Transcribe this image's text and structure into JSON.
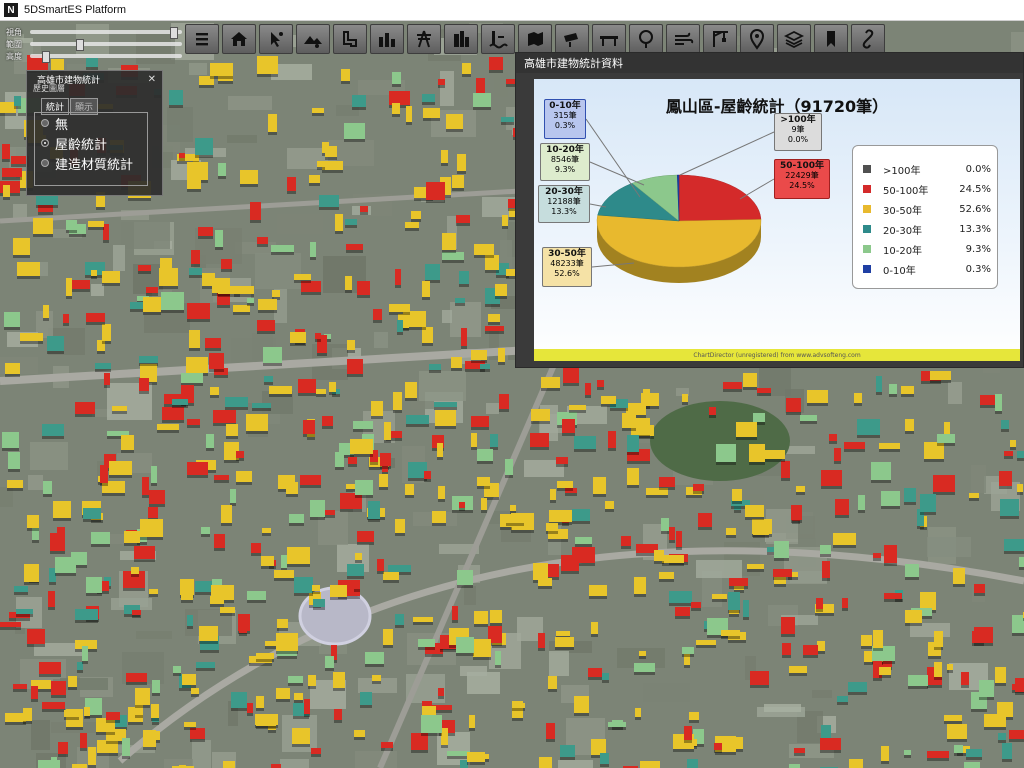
{
  "window": {
    "title": "5DSmartES Platform",
    "icon_letter": "N"
  },
  "sliders": [
    {
      "label": "視角"
    },
    {
      "label": "範圍"
    },
    {
      "label": "高度"
    }
  ],
  "toolbar": [
    {
      "name": "menu-icon"
    },
    {
      "name": "home-icon"
    },
    {
      "name": "select-pointer-icon"
    },
    {
      "name": "terrain-vehicle-icon"
    },
    {
      "name": "pipe-icon"
    },
    {
      "name": "building-stats-icon"
    },
    {
      "name": "power-tower-icon"
    },
    {
      "name": "city-buildings-icon"
    },
    {
      "name": "water-level-icon"
    },
    {
      "name": "map-layers-icon"
    },
    {
      "name": "cctv-camera-icon"
    },
    {
      "name": "bridge-icon"
    },
    {
      "name": "tree-icon"
    },
    {
      "name": "wind-icon"
    },
    {
      "name": "crane-construction-icon"
    },
    {
      "name": "map-pin-icon"
    },
    {
      "name": "layers-stack-icon"
    },
    {
      "name": "bookmark-icon"
    },
    {
      "name": "link-icon"
    }
  ],
  "left_panel": {
    "title": "高雄市建物統計",
    "subtitle": "歷史圖層",
    "tabs": [
      "統計",
      "顯示"
    ],
    "options": [
      {
        "label": "無",
        "selected": false
      },
      {
        "label": "屋齡統計",
        "selected": true
      },
      {
        "label": "建造材質統計",
        "selected": false
      }
    ]
  },
  "stats_window": {
    "title": "高雄市建物統計資料",
    "footer": "ChartDirector (unregistered) from www.advsofteng.com"
  },
  "chart_data": {
    "type": "pie",
    "title": "鳳山區-屋齡統計（91720筆）",
    "total": 91720,
    "unit": "筆",
    "slices": [
      {
        "label": ">100年",
        "count": 9,
        "percent": "0.0%",
        "color": "#505050"
      },
      {
        "label": "50-100年",
        "count": 22429,
        "percent": "24.5%",
        "color": "#d42a2a"
      },
      {
        "label": "30-50年",
        "count": 48233,
        "percent": "52.6%",
        "color": "#e8b92e"
      },
      {
        "label": "20-30年",
        "count": 12188,
        "percent": "13.3%",
        "color": "#2e8a8a"
      },
      {
        "label": "10-20年",
        "count": 8546,
        "percent": "9.3%",
        "color": "#8cc88c"
      },
      {
        "label": "0-10年",
        "count": 315,
        "percent": "0.3%",
        "color": "#1f3fa3"
      }
    ],
    "callouts": [
      {
        "label": "0-10年",
        "count_text": "315筆",
        "percent": "0.3%"
      },
      {
        "label": "10-20年",
        "count_text": "8546筆",
        "percent": "9.3%"
      },
      {
        "label": "20-30年",
        "count_text": "12188筆",
        "percent": "13.3%"
      },
      {
        "label": "30-50年",
        "count_text": "48233筆",
        "percent": "52.6%"
      },
      {
        "label": ">100年",
        "count_text": "9筆",
        "percent": "0.0%"
      },
      {
        "label": "50-100年",
        "count_text": "22429筆",
        "percent": "24.5%"
      }
    ],
    "legend_placement": "right"
  }
}
